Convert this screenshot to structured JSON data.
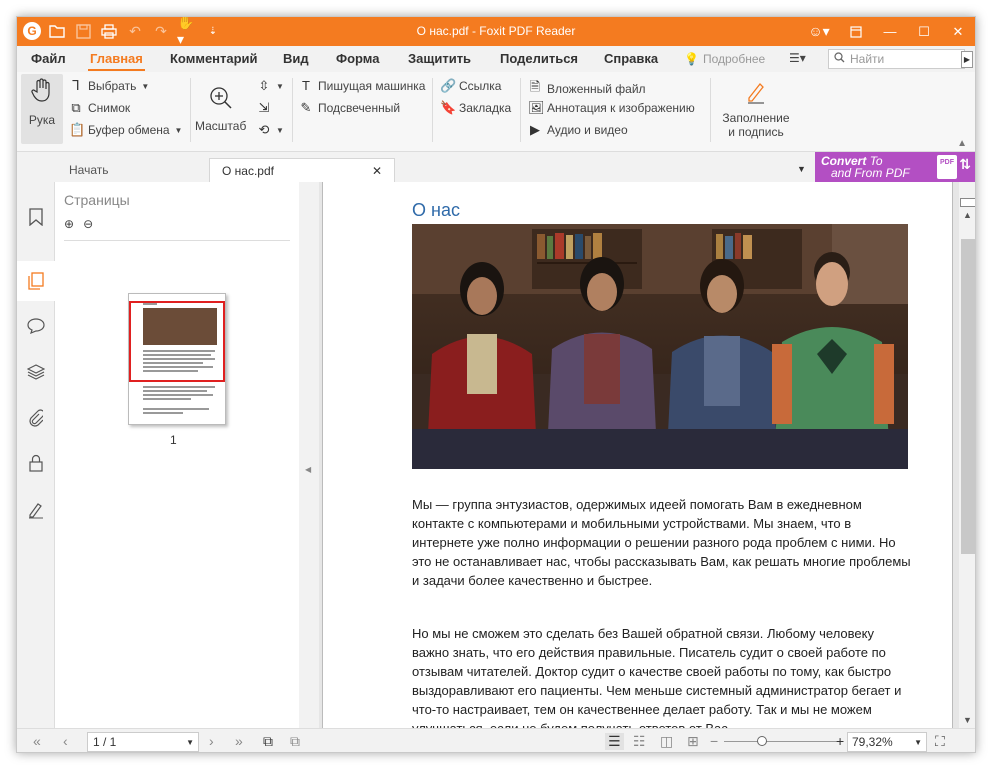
{
  "titlebar": {
    "title": "О нас.pdf - Foxit PDF Reader",
    "quick_access_icons": [
      "foxit-logo",
      "open-folder",
      "save",
      "print",
      "undo",
      "redo",
      "hand",
      "customize"
    ],
    "controls": [
      "user",
      "minimize",
      "maximize",
      "close"
    ]
  },
  "menu": {
    "items": [
      "Файл",
      "Главная",
      "Комментарий",
      "Вид",
      "Форма",
      "Защитить",
      "Поделиться",
      "Справка"
    ],
    "active": "Главная",
    "tell_me": "Подробнее",
    "search_placeholder": "Найти"
  },
  "ribbon": {
    "hand": "Рука",
    "select": "Выбрать",
    "snapshot": "Снимок",
    "clipboard": "Буфер обмена",
    "zoom": "Масштаб",
    "typewriter": "Пишущая машинка",
    "highlight": "Подсвеченный",
    "link": "Ссылка",
    "bookmark": "Закладка",
    "attachment": "Вложенный файл",
    "image_annotation": "Аннотация к изображению",
    "audio_video": "Аудио и видео",
    "fill_sign_line1": "Заполнение",
    "fill_sign_line2": "и подпись"
  },
  "tabs": {
    "start": "Начать",
    "doc": "О нас.pdf",
    "convert_line1": "Convert",
    "convert_to": "To",
    "convert_line2": "and From PDF",
    "convert_badge": "PDF"
  },
  "panel": {
    "title": "Страницы",
    "thumb_page": "1"
  },
  "document": {
    "heading": "О нас",
    "para1": "Мы — группа энтузиастов, одержимых идеей помогать Вам в ежедневном контакте с компьютерами и мобильными устройствами. Мы знаем, что в интернете уже полно информации о решении разного рода проблем с ними. Но это не останавливает нас, чтобы рассказывать Вам, как решать многие проблемы и задачи более качественно и быстрее.",
    "para2": "Но мы не сможем это сделать без Вашей обратной связи. Любому человеку важно знать, что его действия правильные. Писатель судит о своей работе по отзывам читателей. Доктор судит о качестве своей работы по тому, как быстро выздоравливают его пациенты. Чем меньше системный администратор бегает и что-то настраивает, тем он качественнее делает работу. Так и мы не можем улучшаться, если не будем получать ответов от Вас."
  },
  "status": {
    "page_value": "1 / 1",
    "zoom_value": "79,32%",
    "zoom_level": 0.33
  },
  "colors": {
    "accent": "#f47b20",
    "convert_bg": "#b34fc3",
    "heading": "#2f6aa9",
    "selection": "#e02020"
  }
}
